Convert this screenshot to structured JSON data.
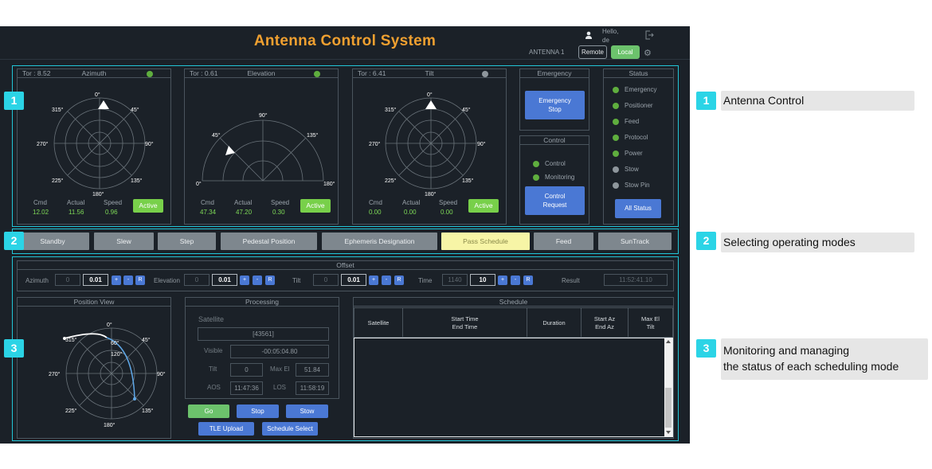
{
  "header": {
    "title": "Antenna Control System",
    "antenna": "ANTENNA 1",
    "remote": "Remote",
    "local": "Local",
    "hello": "Hello,",
    "user": "de"
  },
  "panels": {
    "azimuth": {
      "tor": "Tor : 8.52",
      "title": "Azimuth",
      "cmd_label": "Cmd",
      "actual_label": "Actual",
      "speed_label": "Speed",
      "cmd": "12.02",
      "actual": "11.56",
      "speed": "0.96",
      "active": "Active",
      "labels": [
        "0°",
        "45°",
        "90°",
        "135°",
        "180°",
        "225°",
        "270°",
        "315°"
      ]
    },
    "elevation": {
      "tor": "Tor : 0.61",
      "title": "Elevation",
      "cmd_label": "Cmd",
      "actual_label": "Actual",
      "speed_label": "Speed",
      "cmd": "47.34",
      "actual": "47.20",
      "speed": "0.30",
      "active": "Active",
      "labels": [
        "0°",
        "45°",
        "90°",
        "135°",
        "180°"
      ]
    },
    "tilt": {
      "tor": "Tor : 6.41",
      "title": "Tilt",
      "cmd_label": "Cmd",
      "actual_label": "Actual",
      "speed_label": "Speed",
      "cmd": "0.00",
      "actual": "0.00",
      "speed": "0.00",
      "active": "Active",
      "labels": [
        "0°",
        "45°",
        "90°",
        "135°",
        "180°",
        "225°",
        "270°",
        "315°"
      ]
    }
  },
  "emergency": {
    "title": "Emergency",
    "btn1": "Emergency",
    "btn2": "Stop"
  },
  "control": {
    "title": "Control",
    "items": [
      "Control",
      "Monitoring"
    ],
    "btn1": "Control",
    "btn2": "Request"
  },
  "status": {
    "title": "Status",
    "items": [
      "Emergency",
      "Positioner",
      "Feed",
      "Protocol",
      "Power",
      "Stow",
      "Stow Pin"
    ],
    "all": "All Status"
  },
  "modes": [
    "Standby",
    "Slew",
    "Step",
    "Pedestal Position",
    "Ephemeris Designation",
    "Pass Schedule",
    "Feed",
    "SunTrack"
  ],
  "offset": {
    "title": "Offset",
    "az_label": "Azimuth",
    "az_cur": "0",
    "az_val": "0.01",
    "el_label": "Elevation",
    "el_cur": "0",
    "el_val": "0.01",
    "tilt_label": "Tilt",
    "tilt_cur": "0",
    "tilt_val": "0.01",
    "time_label": "Time",
    "time_cur": "1140",
    "time_val": "10",
    "result_label": "Result",
    "result": "11:52:41.10",
    "plus": "+",
    "minus": "-",
    "r": "R"
  },
  "position_view": {
    "title": "Position View",
    "labels": [
      "0°",
      "45°",
      "90°",
      "135°",
      "180°",
      "225°",
      "270°",
      "315°"
    ],
    "ring_labels": [
      "60°",
      "120°"
    ]
  },
  "processing": {
    "title": "Processing",
    "satellite_label": "Satellite",
    "satellite": "[43561]",
    "visible_label": "Visible",
    "visible": "-00:05:04.80",
    "tilt_label": "Tilt",
    "tilt": "0",
    "maxel_label": "Max El",
    "maxel": "51.84",
    "aos_label": "AOS",
    "aos": "11:47:36",
    "los_label": "LOS",
    "los": "11:58:19"
  },
  "actions": {
    "go": "Go",
    "stop": "Stop",
    "stow": "Stow",
    "tle": "TLE Upload",
    "schedule": "Schedule Select"
  },
  "schedule": {
    "title": "Schedule",
    "cols": [
      "Satellite",
      "Start Time",
      "End Time",
      "Duration",
      "Start Az",
      "End Az",
      "Max El",
      "Tilt"
    ]
  },
  "callouts": [
    {
      "num": "1",
      "label": "Antenna Control"
    },
    {
      "num": "2",
      "label": "Selecting operating modes"
    },
    {
      "num": "3",
      "label": "Monitoring and managing",
      "label2": "the status of each scheduling mode"
    }
  ],
  "colors": {
    "accent": "#22c4d6",
    "title": "#f0a030",
    "green": "#78d04a",
    "blue": "#4a78d4",
    "selected": "#f7f5a6"
  }
}
